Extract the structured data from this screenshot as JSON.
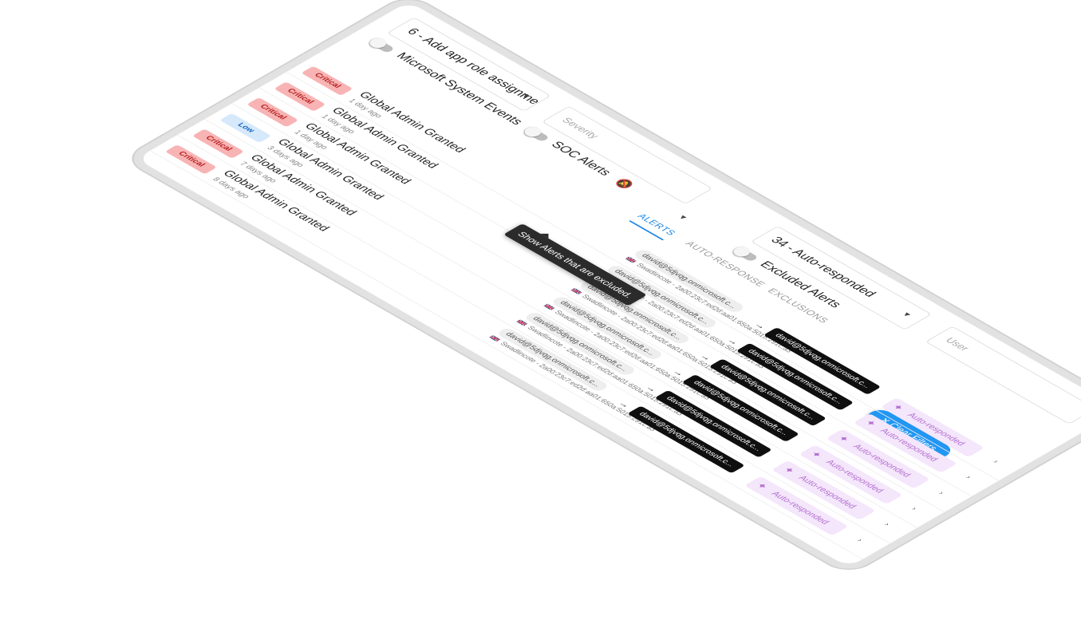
{
  "filters": {
    "event_type": "6 - Add app role assignment...",
    "microsoft_toggle_label": "Microsoft System Events",
    "severity_placeholder": "Severity",
    "soc_toggle_label": "SOC Alerts",
    "auto_response": "34 - Auto-responded",
    "excluded_toggle_label": "Excluded Alerts",
    "user_placeholder": "User",
    "clear_label": "Clear Filters",
    "tooltip": "Show Alerts that are excluded."
  },
  "tabs": [
    {
      "label": "ALERTS",
      "active": true
    },
    {
      "label": "AUTO-RESPONSE",
      "active": false
    },
    {
      "label": "EXCLUSIONS",
      "active": false
    }
  ],
  "rows": [
    {
      "severity": "Critical",
      "title": "Global Admin Granted",
      "age": "1 day ago",
      "from": "david@5djvqg.onmicrosoft.c...",
      "location": "Swadlincote - 2a00:23c7:ed2d:aa01:650a:5015:291c:a3",
      "to": "david@5djvqg.onmicrosoft.c...",
      "status": "Auto-responded"
    },
    {
      "severity": "Critical",
      "title": "Global Admin Granted",
      "age": "1 day ago",
      "from": "david@5djvqg.onmicrosoft.c...",
      "location": "Swadlincote - 2a00:23c7:ed2d:aa01:650a:5015:291c:a3",
      "to": "david@5djvqg.onmicrosoft.c...",
      "status": "Auto-responded"
    },
    {
      "severity": "Critical",
      "title": "Global Admin Granted",
      "age": "1 day ago",
      "from": "david@5djvqg.onmicrosoft.c...",
      "location": "Swadlincote - 2a00:23c7:ed2d:aa01:650a:5015:291c:a3",
      "to": "david@5djvqg.onmicrosoft.c...",
      "status": "Auto-responded"
    },
    {
      "severity": "Low",
      "title": "Global Admin Granted",
      "age": "3 days ago",
      "from": "david@5djvqg.onmicrosoft.c...",
      "location": "Swadlincote - 2a00:23c7:ed2d:aa01:650a:5015:291c:a3",
      "to": "david@5djvqg.onmicrosoft.c...",
      "status": "Auto-responded"
    },
    {
      "severity": "Critical",
      "title": "Global Admin Granted",
      "age": "7 days ago",
      "from": "david@5djvqg.onmicrosoft.c...",
      "location": "Swadlincote - 2a00:23c7:ed2d:aa01:650a:5015:291c:a3",
      "to": "david@5djvqg.onmicrosoft.c...",
      "status": "Auto-responded"
    },
    {
      "severity": "Critical",
      "title": "Global Admin Granted",
      "age": "8 days ago",
      "from": "david@5djvqg.onmicrosoft.c...",
      "location": "Swadlincote - 2a00:23c7:ed2d:aa01:650a:5015:291c:a3",
      "to": "david@5djvqg.onmicrosoft.c...",
      "status": "Auto-responded"
    }
  ],
  "icons": {
    "bell": "bell-slash-icon",
    "flag": "uk-flag-icon",
    "sparkle": "sparkle-icon",
    "chevron": "chevron-icon",
    "close": "close-icon",
    "caret": "caret-down-icon"
  },
  "colors": {
    "accent": "#2196f3",
    "critical_bg": "#f8b4b4",
    "critical_text": "#b71c1c",
    "low_bg": "#d6e9fb",
    "low_text": "#1565c0",
    "auto_bg": "#f4e6fb",
    "auto_text": "#b46fd0"
  }
}
